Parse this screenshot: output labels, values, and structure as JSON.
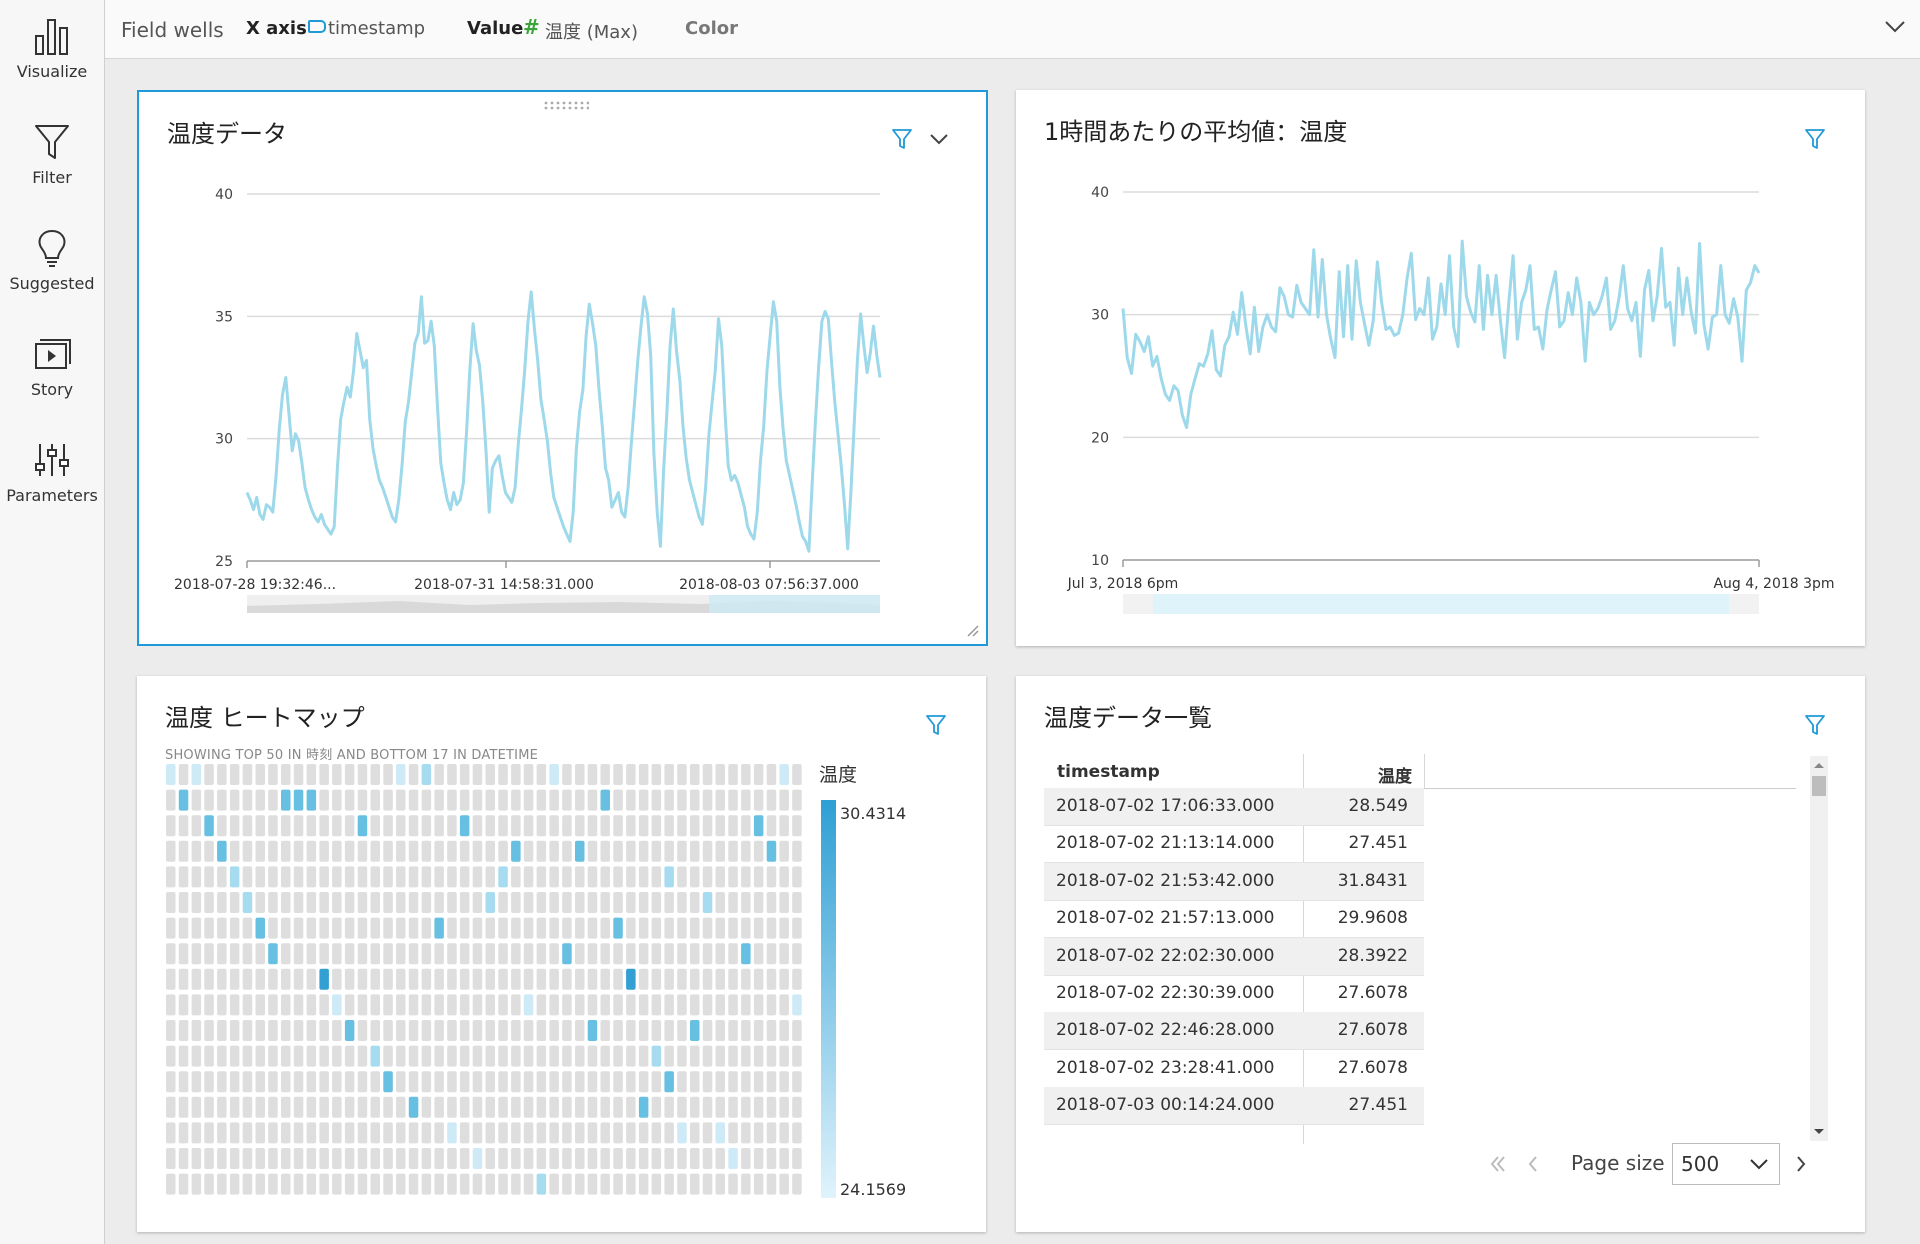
{
  "sidebar": {
    "items": [
      {
        "label": "Visualize",
        "icon": "bar-chart-icon"
      },
      {
        "label": "Filter",
        "icon": "filter-icon"
      },
      {
        "label": "Suggested",
        "icon": "lightbulb-icon"
      },
      {
        "label": "Story",
        "icon": "story-icon"
      },
      {
        "label": "Parameters",
        "icon": "sliders-icon"
      }
    ]
  },
  "fieldwells": {
    "title": "Field wells",
    "xaxis_label": "X axis",
    "xaxis_value": "timestamp",
    "value_label": "Value",
    "value_value": "温度 (Max)",
    "color_label": "Color"
  },
  "card1": {
    "title": "温度データ",
    "chart_data": {
      "type": "line",
      "x_tick_labels": [
        "2018-07-28 19:32:46...",
        "2018-07-31 14:58:31.000",
        "2018-08-03 07:56:37.000"
      ],
      "y_ticks": [
        25,
        30,
        35,
        40
      ],
      "ylim": [
        25,
        40
      ],
      "series": [
        {
          "values": [
            27.8,
            27.5,
            27.1,
            27.6,
            26.9,
            26.7,
            27.3,
            27.2,
            27.0,
            28.5,
            30.4,
            31.8,
            32.5,
            31.0,
            29.5,
            30.2,
            29.9,
            29.0,
            28.0,
            27.5,
            27.1,
            26.8,
            26.6,
            26.9,
            26.5,
            26.3,
            26.1,
            26.4,
            28.8,
            30.8,
            31.5,
            32.1,
            31.7,
            32.8,
            34.3,
            33.6,
            32.9,
            33.2,
            30.8,
            29.6,
            28.9,
            28.3,
            28.0,
            27.6,
            27.2,
            26.8,
            26.6,
            27.5,
            28.9,
            30.7,
            31.5,
            32.7,
            33.9,
            34.3,
            35.8,
            33.9,
            34.0,
            34.8,
            33.8,
            31.3,
            29.0,
            28.2,
            27.5,
            27.1,
            27.8,
            27.3,
            27.5,
            28.2,
            30.3,
            32.8,
            34.7,
            33.6,
            33.0,
            31.5,
            29.5,
            27.0,
            28.8,
            29.1,
            29.3,
            28.5,
            27.8,
            27.6,
            27.4,
            28.0,
            29.8,
            31.2,
            32.8,
            34.8,
            36.0,
            34.5,
            33.2,
            31.6,
            30.8,
            29.9,
            28.6,
            27.6,
            27.2,
            26.8,
            26.4,
            26.1,
            25.8,
            27.0,
            29.6,
            31.1,
            32.0,
            34.2,
            35.5,
            34.7,
            33.8,
            32.0,
            30.5,
            28.8,
            28.3,
            27.2,
            27.5,
            27.8,
            27.0,
            26.8,
            28.0,
            29.8,
            31.5,
            33.2,
            34.6,
            35.8,
            35.1,
            33.4,
            29.4,
            27.0,
            25.6,
            28.7,
            31.0,
            33.8,
            35.3,
            33.6,
            32.4,
            30.5,
            29.2,
            28.3,
            27.8,
            27.3,
            26.8,
            26.5,
            28.0,
            30.1,
            31.5,
            32.8,
            34.9,
            33.8,
            31.1,
            28.9,
            28.3,
            28.5,
            28.2,
            27.7,
            27.2,
            26.4,
            26.1,
            25.9,
            27.0,
            29.1,
            30.5,
            32.8,
            34.2,
            35.6,
            34.8,
            32.1,
            30.4,
            29.1,
            28.5,
            27.9,
            27.3,
            26.6,
            26.0,
            25.8,
            25.4,
            28.2,
            30.7,
            32.9,
            34.8,
            35.2,
            34.9,
            33.1,
            31.5,
            30.2,
            28.9,
            27.3,
            25.5,
            27.8,
            30.6,
            33.2,
            35.1,
            33.8,
            32.7,
            33.5,
            34.6,
            33.4,
            32.5
          ]
        }
      ]
    }
  },
  "card2": {
    "title": "1時間あたりの平均値：温度",
    "chart_data": {
      "type": "line",
      "x_tick_labels": [
        "Jul 3, 2018 6pm",
        "Aug 4, 2018 3pm"
      ],
      "y_ticks": [
        10,
        20,
        30,
        40
      ],
      "ylim": [
        10,
        40
      ],
      "series": [
        {
          "values": [
            30.5,
            26.5,
            25.2,
            28.4,
            27.8,
            27.0,
            28.2,
            25.8,
            26.6,
            24.8,
            23.5,
            23.0,
            24.2,
            23.8,
            21.8,
            20.8,
            23.5,
            24.8,
            26.0,
            25.8,
            26.8,
            28.7,
            25.5,
            25.0,
            27.5,
            28.2,
            30.2,
            28.4,
            31.8,
            29.0,
            26.8,
            30.6,
            27.0,
            29.0,
            30.0,
            29.0,
            28.6,
            32.2,
            31.5,
            30.0,
            29.8,
            32.4,
            31.0,
            30.5,
            30.0,
            35.3,
            29.8,
            34.5,
            30.0,
            28.0,
            26.5,
            33.5,
            28.2,
            34.0,
            28.0,
            34.4,
            31.0,
            29.2,
            27.5,
            29.5,
            34.3,
            31.0,
            28.8,
            29.0,
            28.3,
            28.5,
            30.0,
            33.0,
            35.0,
            29.6,
            30.5,
            30.0,
            33.0,
            28.0,
            29.0,
            32.5,
            30.0,
            34.8,
            29.0,
            27.4,
            36.0,
            31.5,
            30.2,
            29.4,
            34.0,
            28.8,
            33.2,
            30.0,
            33.2,
            29.5,
            26.5,
            31.0,
            34.8,
            28.0,
            31.0,
            32.0,
            34.0,
            28.8,
            29.0,
            27.2,
            30.4,
            32.0,
            33.5,
            29.0,
            29.5,
            31.8,
            30.0,
            33.0,
            31.0,
            26.2,
            31.0,
            30.0,
            30.5,
            31.5,
            33.0,
            28.8,
            29.5,
            31.4,
            34.0,
            30.5,
            29.5,
            31.0,
            26.6,
            32.0,
            33.6,
            29.5,
            31.5,
            35.4,
            30.6,
            31.0,
            27.5,
            33.8,
            30.0,
            33.0,
            30.2,
            28.5,
            35.8,
            29.2,
            27.2,
            29.8,
            30.0,
            34.0,
            30.0,
            29.3,
            31.3,
            29.8,
            26.2,
            32.0,
            32.6,
            34.0,
            33.4
          ]
        }
      ]
    }
  },
  "card3": {
    "title": "温度 ヒートマップ",
    "subtitle": "SHOWING TOP 50 IN 時刻 AND BOTTOM 17 IN DATETIME",
    "legend_title": "温度",
    "legend_max": "30.4314",
    "legend_min": "24.1569",
    "chart_data": {
      "type": "heatmap",
      "rows": 17,
      "cols": 50,
      "value_range": [
        24.1569,
        30.4314
      ],
      "colored_cells": [
        [
          0,
          0,
          1
        ],
        [
          0,
          2,
          1
        ],
        [
          0,
          18,
          1
        ],
        [
          0,
          20,
          2
        ],
        [
          0,
          30,
          1
        ],
        [
          0,
          48,
          1
        ],
        [
          1,
          1,
          3
        ],
        [
          1,
          9,
          3
        ],
        [
          1,
          10,
          3
        ],
        [
          1,
          11,
          3
        ],
        [
          1,
          34,
          3
        ],
        [
          2,
          3,
          3
        ],
        [
          2,
          15,
          3
        ],
        [
          2,
          23,
          3
        ],
        [
          2,
          46,
          3
        ],
        [
          3,
          4,
          3
        ],
        [
          3,
          27,
          3
        ],
        [
          3,
          32,
          3
        ],
        [
          3,
          47,
          3
        ],
        [
          4,
          5,
          2
        ],
        [
          4,
          26,
          2
        ],
        [
          4,
          39,
          2
        ],
        [
          5,
          6,
          2
        ],
        [
          5,
          25,
          2
        ],
        [
          5,
          42,
          2
        ],
        [
          6,
          7,
          3
        ],
        [
          6,
          21,
          3
        ],
        [
          6,
          35,
          3
        ],
        [
          7,
          8,
          3
        ],
        [
          7,
          31,
          3
        ],
        [
          7,
          45,
          3
        ],
        [
          8,
          12,
          4
        ],
        [
          8,
          36,
          4
        ],
        [
          9,
          13,
          1
        ],
        [
          9,
          28,
          1
        ],
        [
          9,
          49,
          1
        ],
        [
          10,
          14,
          3
        ],
        [
          10,
          33,
          3
        ],
        [
          10,
          41,
          3
        ],
        [
          11,
          16,
          2
        ],
        [
          11,
          38,
          2
        ],
        [
          12,
          17,
          3
        ],
        [
          12,
          39,
          3
        ],
        [
          13,
          19,
          3
        ],
        [
          13,
          37,
          3
        ],
        [
          14,
          22,
          1
        ],
        [
          14,
          40,
          1
        ],
        [
          14,
          43,
          1
        ],
        [
          15,
          24,
          1
        ],
        [
          15,
          44,
          1
        ],
        [
          16,
          29,
          2
        ]
      ]
    }
  },
  "card4": {
    "title": "温度データ一覧",
    "headers": {
      "timestamp": "timestamp",
      "value": "温度"
    },
    "rows": [
      {
        "ts": "2018-07-02 17:06:33.000",
        "v": "28.549"
      },
      {
        "ts": "2018-07-02 21:13:14.000",
        "v": "27.451"
      },
      {
        "ts": "2018-07-02 21:53:42.000",
        "v": "31.8431"
      },
      {
        "ts": "2018-07-02 21:57:13.000",
        "v": "29.9608"
      },
      {
        "ts": "2018-07-02 22:02:30.000",
        "v": "28.3922"
      },
      {
        "ts": "2018-07-02 22:30:39.000",
        "v": "27.6078"
      },
      {
        "ts": "2018-07-02 22:46:28.000",
        "v": "27.6078"
      },
      {
        "ts": "2018-07-02 23:28:41.000",
        "v": "27.6078"
      },
      {
        "ts": "2018-07-03 00:14:24.000",
        "v": "27.451"
      }
    ],
    "pager": {
      "page_size_label": "Page size",
      "page_size": "500"
    }
  },
  "colors": {
    "line": "#9dd9ea",
    "accent": "#1f9ad6",
    "heat_empty": "#dedede"
  }
}
